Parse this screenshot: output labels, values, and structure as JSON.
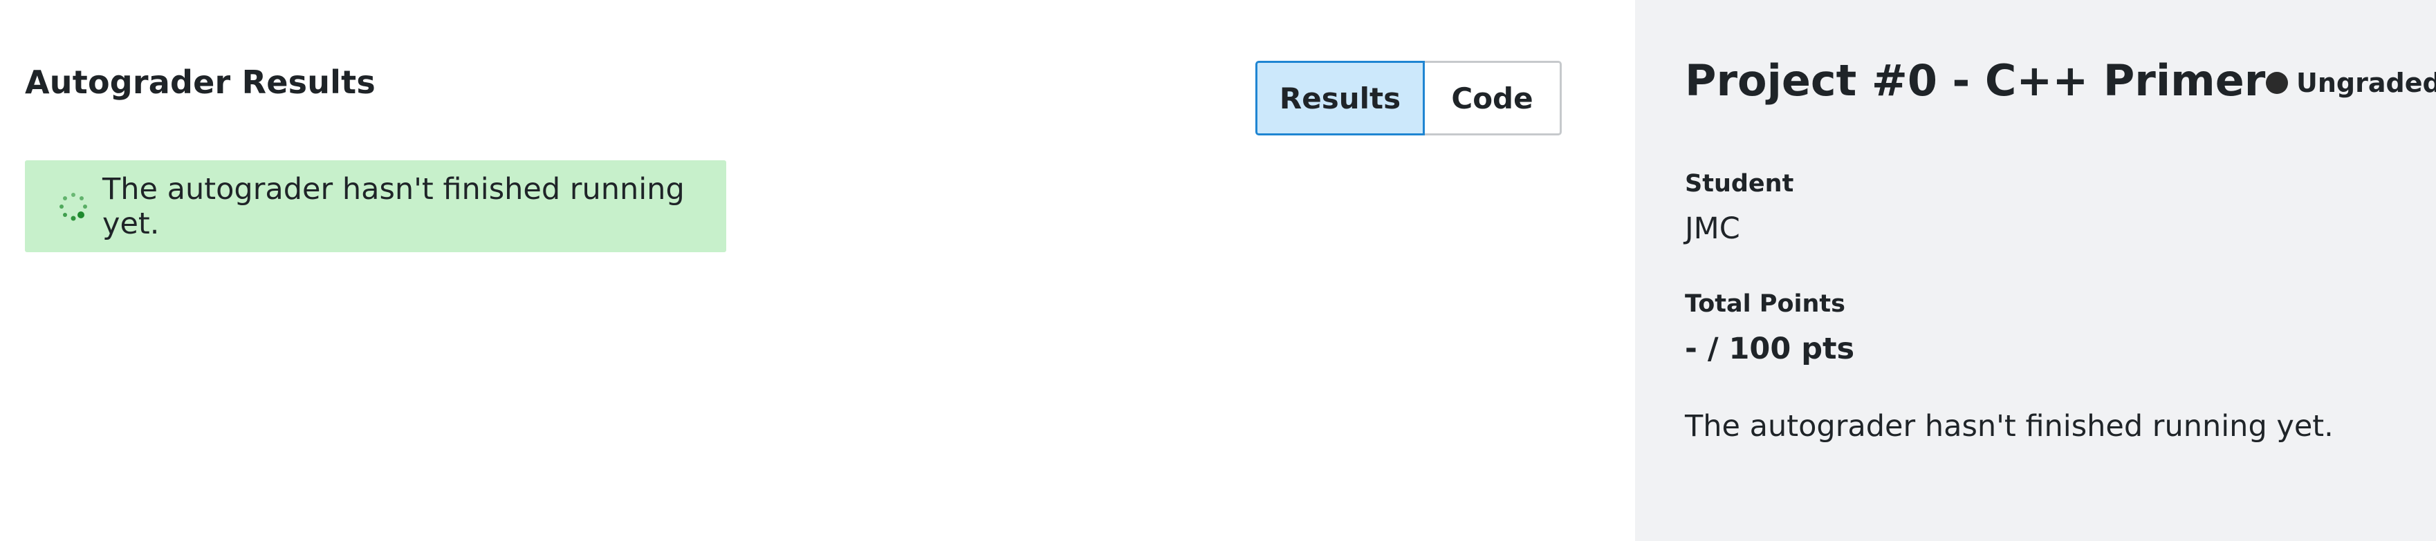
{
  "main": {
    "section_title": "Autograder Results",
    "view_toggle": {
      "results_label": "Results",
      "code_label": "Code",
      "selected": "Results"
    },
    "alert": {
      "icon": "loading-spinner-icon",
      "message": "The autograder hasn't finished running yet."
    }
  },
  "sidebar": {
    "assignment_title": "Project #0 - C++ Primer",
    "status": {
      "icon": "status-dot-icon",
      "label": "Ungraded"
    },
    "student": {
      "label": "Student",
      "value": "JMC"
    },
    "total_points": {
      "label": "Total Points",
      "value": "- / 100 pts"
    },
    "message": "The autograder hasn't finished running yet."
  },
  "colors": {
    "alert_background": "#c7f0cb",
    "spinner": "#1e8a2e",
    "toggle_selected_background": "#cce8fb",
    "toggle_selected_border": "#1f85d2",
    "sidebar_background": "#f1f2f4"
  }
}
